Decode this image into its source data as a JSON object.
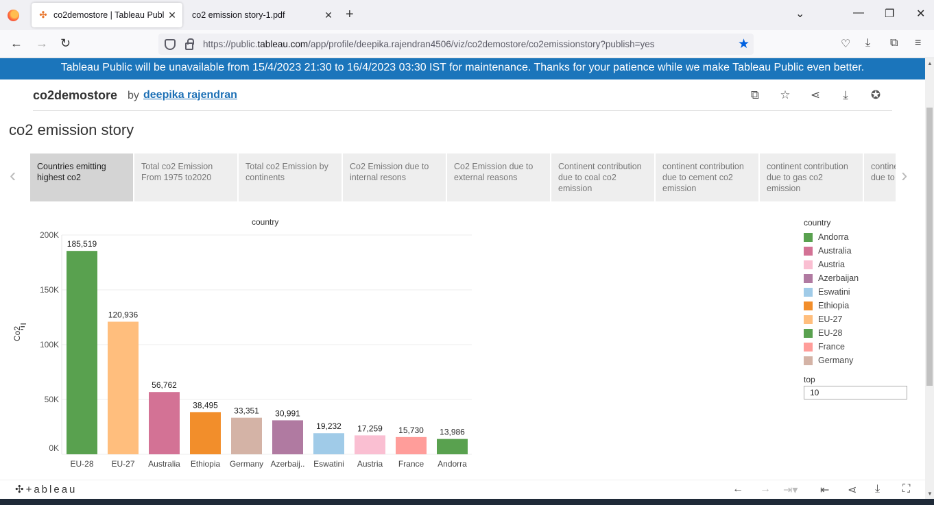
{
  "browser": {
    "tabs": [
      {
        "title": "co2demostore | Tableau Public",
        "active": true
      },
      {
        "title": "co2 emission story-1.pdf",
        "active": false
      }
    ],
    "url_prefix": "https://public.",
    "url_domain": "tableau.com",
    "url_rest": "/app/profile/deepika.rajendran4506/viz/co2demostore/co2emissionstory?publish=yes"
  },
  "banner": "Tableau Public will be unavailable from 15/4/2023 21:30 to 16/4/2023 03:30 IST for maintenance. Thanks for your patience while we make Tableau Public even better.",
  "header": {
    "title": "co2demostore",
    "by": "by",
    "author": "deepika rajendran"
  },
  "story_title": "co2 emission story",
  "story_points": [
    "Countries emitting highest co2",
    "Total co2 Emission From 1975 to2020",
    "Total co2  Emission by continents",
    "Co2 Emission due to internal resons",
    "Co2 Emission due to external reasons",
    "Continent contribution due to coal co2 emission",
    "continent contribution due to cement co2 emission",
    "continent contribution due to gas co2 emission",
    "continent contribution due to ... emission"
  ],
  "chart_data": {
    "type": "bar",
    "title": "country",
    "ylabel": "Co2",
    "xlabel": "",
    "ylim": [
      0,
      200000
    ],
    "yticks": [
      "200K",
      "150K",
      "100K",
      "50K",
      "0K"
    ],
    "categories": [
      "EU-28",
      "EU-27",
      "Australia",
      "Ethiopia",
      "Germany",
      "Azerbaij..",
      "Eswatini",
      "Austria",
      "France",
      "Andorra"
    ],
    "values": [
      185519,
      120936,
      56762,
      38495,
      33351,
      30991,
      19232,
      17259,
      15730,
      13986
    ],
    "value_labels": [
      "185,519",
      "120,936",
      "56,762",
      "38,495",
      "33,351",
      "30,991",
      "19,232",
      "17,259",
      "15,730",
      "13,986"
    ],
    "colors": [
      "#59a14f",
      "#ffbe7d",
      "#d37295",
      "#f28e2b",
      "#d4b3a6",
      "#b07aa1",
      "#a0cbe8",
      "#fabfd2",
      "#ff9d9a",
      "#59a14f"
    ]
  },
  "legend": {
    "title": "country",
    "items": [
      {
        "label": "Andorra",
        "color": "#59a14f"
      },
      {
        "label": "Australia",
        "color": "#d37295"
      },
      {
        "label": "Austria",
        "color": "#fabfd2"
      },
      {
        "label": "Azerbaijan",
        "color": "#b07aa1"
      },
      {
        "label": "Eswatini",
        "color": "#a0cbe8"
      },
      {
        "label": "Ethiopia",
        "color": "#f28e2b"
      },
      {
        "label": "EU-27",
        "color": "#ffbe7d"
      },
      {
        "label": "EU-28",
        "color": "#59a14f"
      },
      {
        "label": "France",
        "color": "#ff9d9a"
      },
      {
        "label": "Germany",
        "color": "#d4b3a6"
      }
    ]
  },
  "top_filter": {
    "label": "top",
    "value": "10"
  },
  "footer": {
    "logo": "+ableau"
  }
}
